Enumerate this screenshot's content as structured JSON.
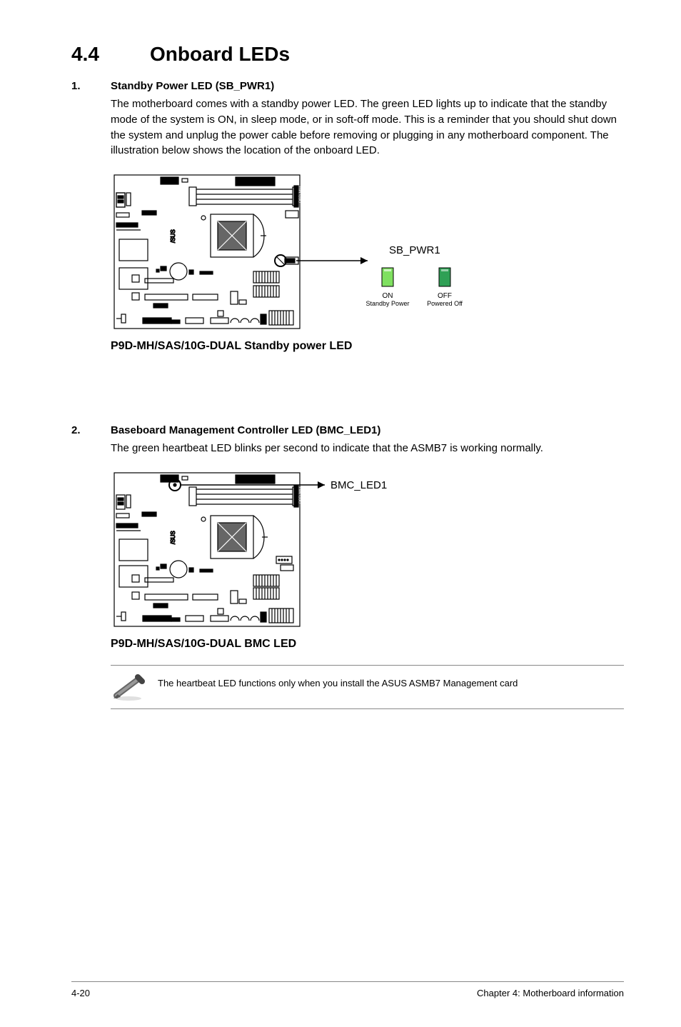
{
  "section": {
    "number": "4.4",
    "title": "Onboard LEDs"
  },
  "items": [
    {
      "num": "1.",
      "heading": "Standby Power LED (SB_PWR1)",
      "body": "The motherboard comes with a standby power LED. The green LED lights up to indicate that the standby mode of the system is ON, in sleep mode, or in soft-off mode. This is a reminder that you should shut down the system and unplug the power cable before removing or plugging in any motherboard component. The illustration below shows the location of the onboard LED.",
      "diagram": {
        "label": "SB_PWR1",
        "state_on": "ON",
        "state_on_sub": "Standby Power",
        "state_off": "OFF",
        "state_off_sub": "Powered Off",
        "caption": "P9D-MH/SAS/10G-DUAL Standby power LED",
        "board_label": "P9D-MH"
      }
    },
    {
      "num": "2.",
      "heading": "Baseboard Management Controller LED (BMC_LED1)",
      "body": "The green heartbeat LED blinks per second to indicate that the ASMB7 is working normally.",
      "diagram": {
        "label": "BMC_LED1",
        "caption": "P9D-MH/SAS/10G-DUAL BMC LED",
        "board_label": "P9D-MH"
      }
    }
  ],
  "note": "The heartbeat LED functions only when you install the ASUS ASMB7 Management card",
  "footer": {
    "page": "4-20",
    "chapter": "Chapter 4: Motherboard information"
  }
}
